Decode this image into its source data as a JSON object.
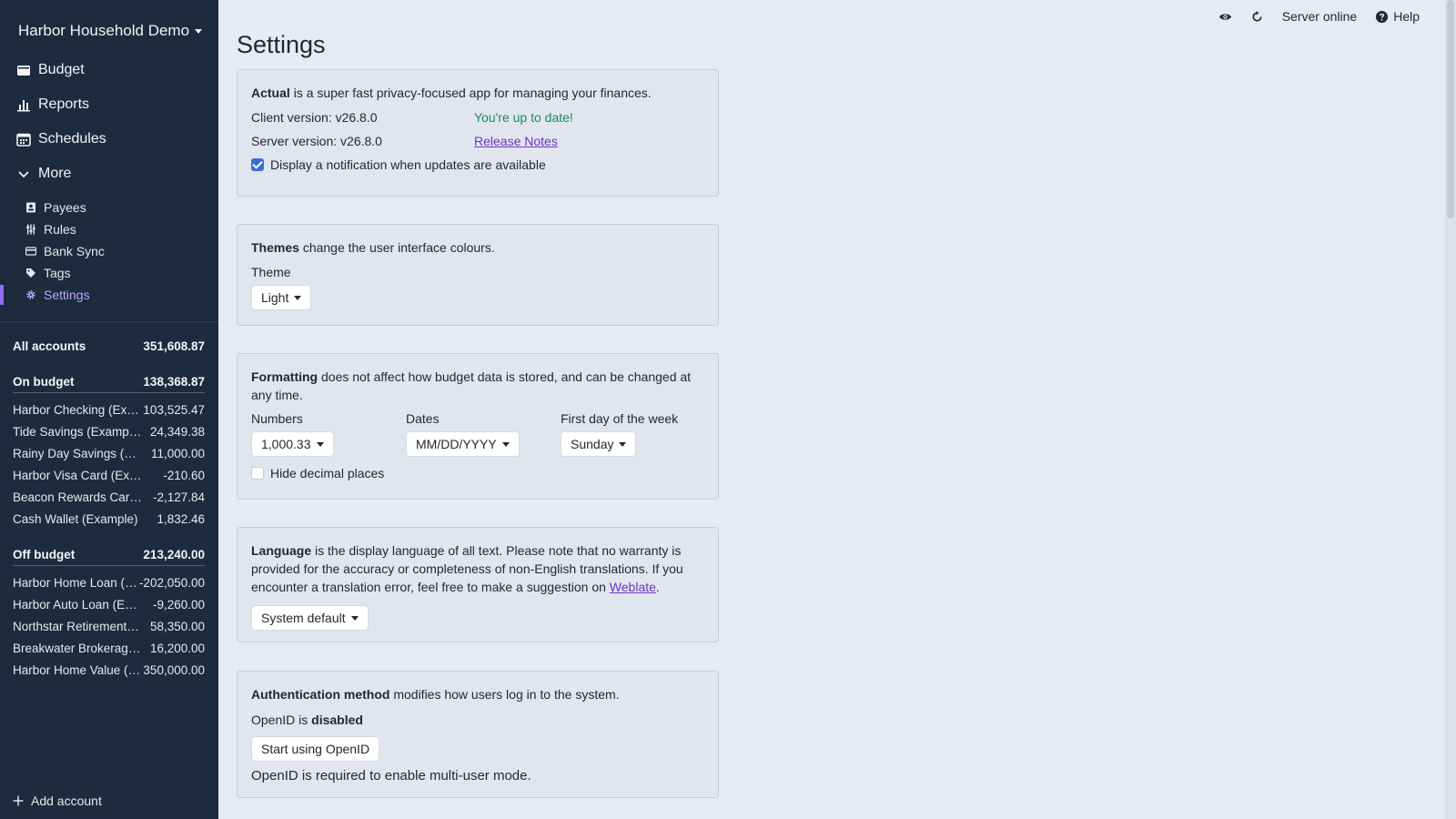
{
  "sidebar": {
    "budget_name": "Harbor Household Demo",
    "nav": {
      "budget": "Budget",
      "reports": "Reports",
      "schedules": "Schedules",
      "more": "More"
    },
    "more_items": {
      "payees": "Payees",
      "rules": "Rules",
      "bank_sync": "Bank Sync",
      "tags": "Tags",
      "settings": "Settings"
    },
    "accounts": {
      "all": {
        "name": "All accounts",
        "balance": "351,608.87"
      },
      "on_budget": {
        "name": "On budget",
        "balance": "138,368.87",
        "items": [
          {
            "name": "Harbor Checking (Example)",
            "balance": "103,525.47"
          },
          {
            "name": "Tide Savings (Example)",
            "balance": "24,349.38"
          },
          {
            "name": "Rainy Day Savings (Example)",
            "balance": "11,000.00"
          },
          {
            "name": "Harbor Visa Card (Example)",
            "balance": "-210.60"
          },
          {
            "name": "Beacon Rewards Card (Example)",
            "balance": "-2,127.84"
          },
          {
            "name": "Cash Wallet (Example)",
            "balance": "1,832.46"
          }
        ]
      },
      "off_budget": {
        "name": "Off budget",
        "balance": "213,240.00",
        "items": [
          {
            "name": "Harbor Home Loan (Example)",
            "balance": "-202,050.00"
          },
          {
            "name": "Harbor Auto Loan (Example)",
            "balance": "-9,260.00"
          },
          {
            "name": "Northstar Retirement (Example)",
            "balance": "58,350.00"
          },
          {
            "name": "Breakwater Brokerage (Example)",
            "balance": "16,200.00"
          },
          {
            "name": "Harbor Home Value (Example)",
            "balance": "350,000.00"
          }
        ]
      }
    },
    "add_account": "Add account"
  },
  "topbar": {
    "server_status": "Server online",
    "help": "Help"
  },
  "page": {
    "title": "Settings"
  },
  "about": {
    "app_name": "Actual",
    "intro": "is a super fast privacy-focused app for managing your finances.",
    "client_version": "Client version: v26.8.0",
    "up_to_date": "You're up to date!",
    "server_version": "Server version: v26.8.0",
    "release_notes": "Release Notes",
    "notify_label": "Display a notification when updates are available"
  },
  "themes": {
    "heading": "Themes",
    "desc": "change the user interface colours.",
    "theme_label": "Theme",
    "theme_value": "Light"
  },
  "formatting": {
    "heading": "Formatting",
    "desc": "does not affect how budget data is stored, and can be changed at any time.",
    "numbers_label": "Numbers",
    "numbers_value": "1,000.33",
    "dates_label": "Dates",
    "dates_value": "MM/DD/YYYY",
    "week_label": "First day of the week",
    "week_value": "Sunday",
    "hide_decimals": "Hide decimal places"
  },
  "language": {
    "heading": "Language",
    "desc": "is the display language of all text. Please note that no warranty is provided for the accuracy or completeness of non-English translations. If you encounter a translation error, feel free to make a suggestion on",
    "link": "Weblate",
    "period": ".",
    "value": "System default"
  },
  "auth": {
    "heading": "Authentication method",
    "desc": "modifies how users log in to the system.",
    "openid_prefix": "OpenID is",
    "openid_status": "disabled",
    "button": "Start using OpenID",
    "note": "OpenID is required to enable multi-user mode."
  },
  "colors": {
    "sidebar_bg": "#1c2b3d",
    "page_bg": "#e7ebf1",
    "accent": "#8b6ff0",
    "link": "#6b35c5",
    "success": "#1c8a55",
    "checkbox": "#3b6fd8"
  }
}
